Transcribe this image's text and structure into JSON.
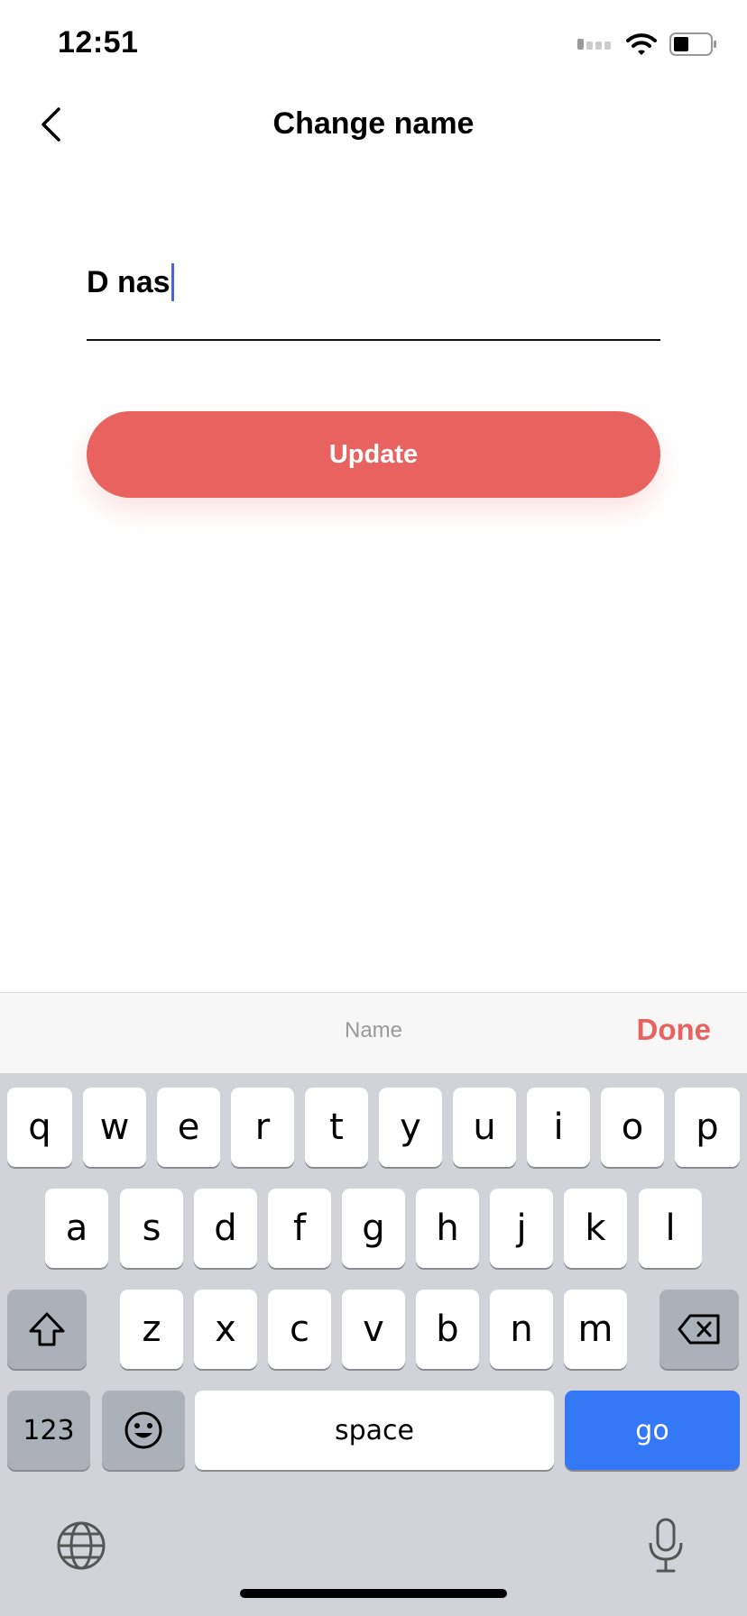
{
  "status_bar": {
    "time": "12:51"
  },
  "header": {
    "title": "Change name"
  },
  "form": {
    "name_value": "D nas",
    "update_label": "Update"
  },
  "accessory_bar": {
    "field_label": "Name",
    "done_label": "Done"
  },
  "keyboard": {
    "row1": [
      "q",
      "w",
      "e",
      "r",
      "t",
      "y",
      "u",
      "i",
      "o",
      "p"
    ],
    "row2": [
      "a",
      "s",
      "d",
      "f",
      "g",
      "h",
      "j",
      "k",
      "l"
    ],
    "row3": [
      "z",
      "x",
      "c",
      "v",
      "b",
      "n",
      "m"
    ],
    "numbers_label": "123",
    "space_label": "space",
    "return_label": "go"
  },
  "colors": {
    "accent": "#e8635f",
    "caret": "#4a66d6",
    "return_key": "#3478f6"
  }
}
